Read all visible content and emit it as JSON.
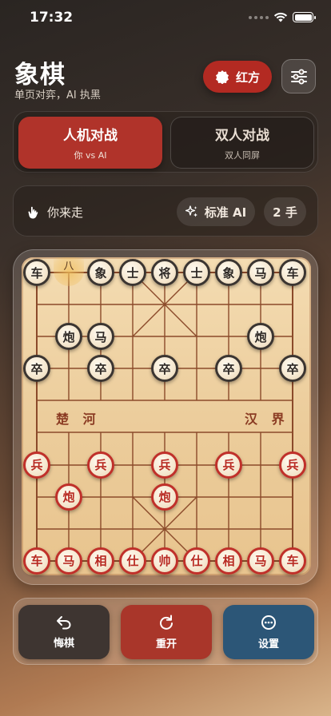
{
  "status_bar": {
    "time": "17:32"
  },
  "header": {
    "title": "象棋",
    "subtitle": "单页对弈，AI 执黑",
    "side_label": "红方"
  },
  "modes": [
    {
      "title": "人机对战",
      "sub": "你 vs AI"
    },
    {
      "title": "双人对战",
      "sub": "双人同屏"
    }
  ],
  "status": {
    "turn": "你来走",
    "ai_level": "标准 AI",
    "moves": "2 手"
  },
  "board": {
    "river_left": "楚 河",
    "river_right": "汉 界",
    "hint_char": "八",
    "pieces": [
      {
        "c": "车",
        "s": "black",
        "f": 0,
        "r": 0
      },
      {
        "c": "象",
        "s": "black",
        "f": 2,
        "r": 0
      },
      {
        "c": "士",
        "s": "black",
        "f": 3,
        "r": 0
      },
      {
        "c": "将",
        "s": "black",
        "f": 4,
        "r": 0
      },
      {
        "c": "士",
        "s": "black",
        "f": 5,
        "r": 0
      },
      {
        "c": "象",
        "s": "black",
        "f": 6,
        "r": 0
      },
      {
        "c": "马",
        "s": "black",
        "f": 7,
        "r": 0
      },
      {
        "c": "车",
        "s": "black",
        "f": 8,
        "r": 0
      },
      {
        "c": "炮",
        "s": "black",
        "f": 1,
        "r": 2
      },
      {
        "c": "马",
        "s": "black",
        "f": 2,
        "r": 2
      },
      {
        "c": "炮",
        "s": "black",
        "f": 7,
        "r": 2
      },
      {
        "c": "卒",
        "s": "black",
        "f": 0,
        "r": 3
      },
      {
        "c": "卒",
        "s": "black",
        "f": 2,
        "r": 3
      },
      {
        "c": "卒",
        "s": "black",
        "f": 4,
        "r": 3
      },
      {
        "c": "卒",
        "s": "black",
        "f": 6,
        "r": 3
      },
      {
        "c": "卒",
        "s": "black",
        "f": 8,
        "r": 3
      },
      {
        "c": "兵",
        "s": "red",
        "f": 0,
        "r": 6
      },
      {
        "c": "兵",
        "s": "red",
        "f": 2,
        "r": 6
      },
      {
        "c": "兵",
        "s": "red",
        "f": 4,
        "r": 6
      },
      {
        "c": "兵",
        "s": "red",
        "f": 6,
        "r": 6
      },
      {
        "c": "兵",
        "s": "red",
        "f": 8,
        "r": 6
      },
      {
        "c": "炮",
        "s": "red",
        "f": 1,
        "r": 7
      },
      {
        "c": "炮",
        "s": "red",
        "f": 4,
        "r": 7
      },
      {
        "c": "车",
        "s": "red",
        "f": 0,
        "r": 9
      },
      {
        "c": "马",
        "s": "red",
        "f": 1,
        "r": 9
      },
      {
        "c": "相",
        "s": "red",
        "f": 2,
        "r": 9
      },
      {
        "c": "仕",
        "s": "red",
        "f": 3,
        "r": 9
      },
      {
        "c": "帅",
        "s": "red",
        "f": 4,
        "r": 9
      },
      {
        "c": "仕",
        "s": "red",
        "f": 5,
        "r": 9
      },
      {
        "c": "相",
        "s": "red",
        "f": 6,
        "r": 9
      },
      {
        "c": "马",
        "s": "red",
        "f": 7,
        "r": 9
      },
      {
        "c": "车",
        "s": "red",
        "f": 8,
        "r": 9
      }
    ]
  },
  "actions": {
    "undo": "悔棋",
    "restart": "重开",
    "settings": "设置"
  },
  "colors": {
    "red_side": "#b32a22",
    "undo_bg": "#3e3531",
    "restart_bg": "#a9362a",
    "settings_bg": "#2c5677"
  }
}
